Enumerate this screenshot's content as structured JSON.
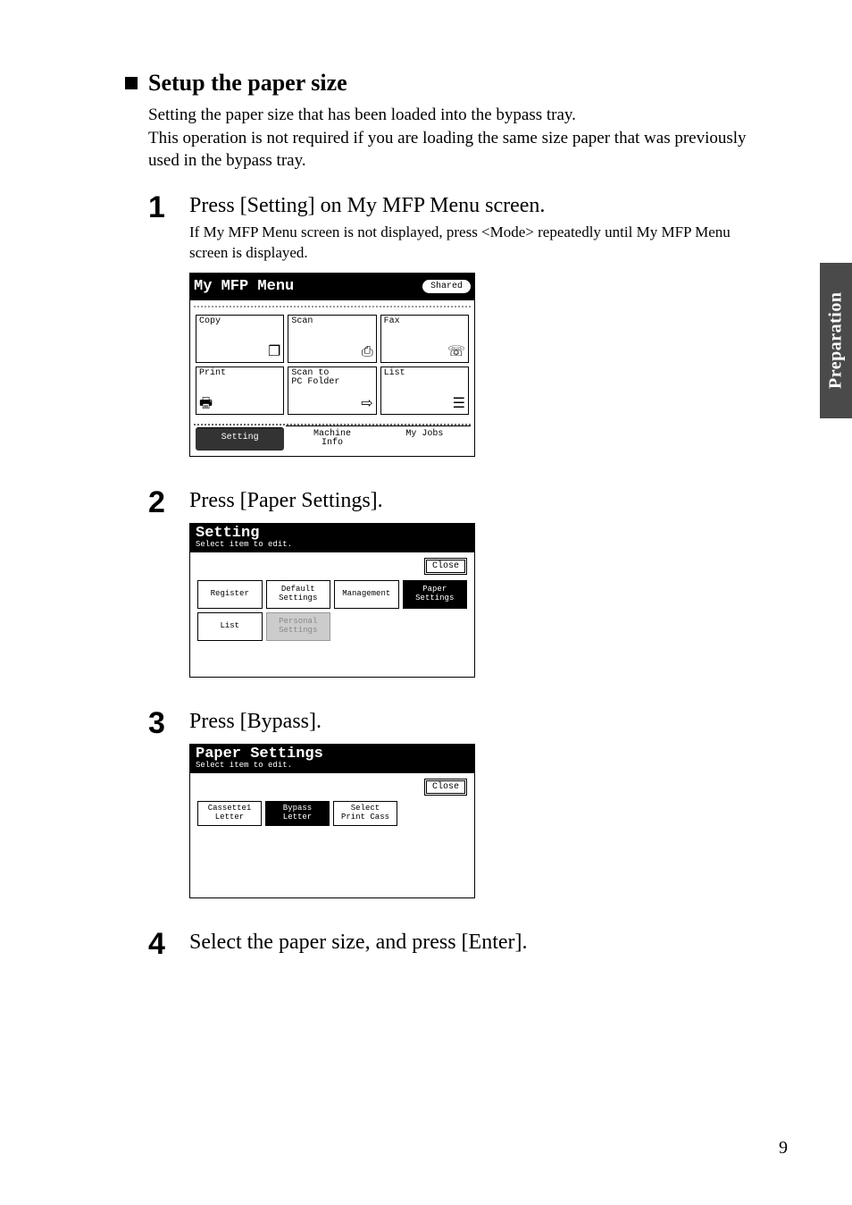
{
  "sideTab": "Preparation",
  "section": {
    "heading": "Setup the paper size",
    "intro": "Setting the paper size that has been loaded into the bypass tray.\nThis operation is not required if you are loading the same size paper that was previously used in the bypass tray."
  },
  "steps": {
    "s1": {
      "num": "1",
      "title": "Press [Setting] on My MFP Menu screen.",
      "note": "If My MFP Menu screen is not displayed, press <Mode> repeatedly until My MFP Menu screen is displayed.",
      "lcd": {
        "title": "My MFP Menu",
        "shared": "Shared",
        "cells": {
          "copy": "Copy",
          "scan": "Scan",
          "fax": "Fax",
          "print": "Print",
          "scantopc": "Scan to\nPC Folder",
          "list": "List"
        },
        "footer": {
          "setting": "Setting",
          "machine": "Machine\nInfo",
          "myjobs": "My Jobs"
        }
      }
    },
    "s2": {
      "num": "2",
      "title": "Press [Paper Settings].",
      "lcd": {
        "title": "Setting",
        "sub": "Select item to edit.",
        "close": "Close",
        "buttons": {
          "register": "Register",
          "default": "Default\nSettings",
          "management": "Management",
          "paper": "Paper\nSettings",
          "list": "List",
          "personal": "Personal\nSettings"
        }
      }
    },
    "s3": {
      "num": "3",
      "title": "Press [Bypass].",
      "lcd": {
        "title": "Paper Settings",
        "sub": "Select item to edit.",
        "close": "Close",
        "buttons": {
          "cassette1": "Cassette1\nLetter",
          "bypass": "Bypass\nLetter",
          "select": "Select\nPrint Cass"
        }
      }
    },
    "s4": {
      "num": "4",
      "title": "Select the paper size, and press [Enter]."
    }
  },
  "pageNumber": "9"
}
